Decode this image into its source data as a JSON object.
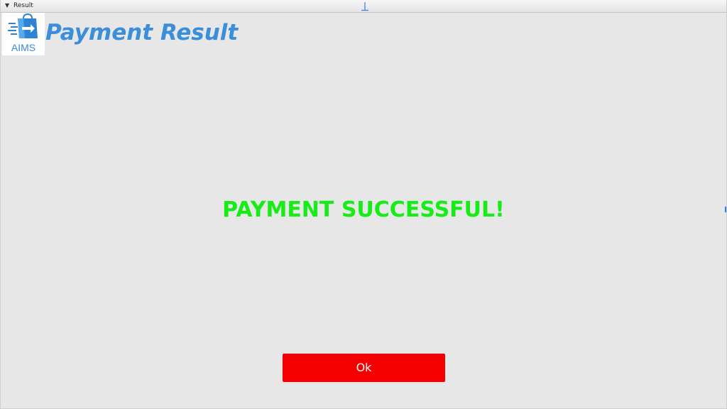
{
  "window": {
    "title": "Result"
  },
  "header": {
    "logo_text": "AIMS",
    "title": "Payment Result"
  },
  "main": {
    "message": "PAYMENT SUCCESSFUL!",
    "message_color": "#16ec16"
  },
  "actions": {
    "ok_label": "Ok",
    "ok_color": "#f50000"
  },
  "colors": {
    "accent": "#3b8ed9",
    "background": "#e8e7e8"
  }
}
